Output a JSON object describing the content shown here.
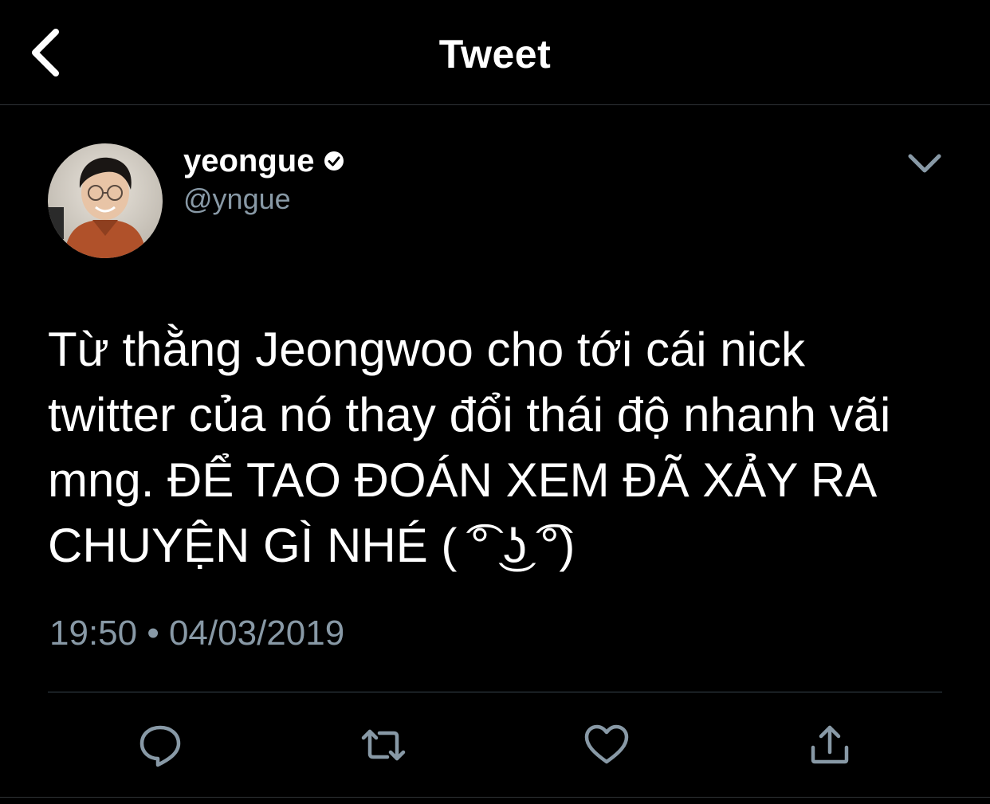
{
  "header": {
    "title": "Tweet",
    "back_icon": "chevron-left-icon"
  },
  "tweet": {
    "author": {
      "display_name": "yeongue",
      "handle": "@yngue",
      "verified": true
    },
    "text": "Từ thằng Jeongwoo cho tới cái nick\ntwitter của nó thay đổi thái độ nhanh vãi\nmng. ĐỂ TAO ĐOÁN XEM ĐÃ XẢY RA\nCHUYỆN GÌ NHÉ ( ͡° ͜ʖ ͡°)",
    "timestamp": "19:50 • 04/03/2019"
  },
  "actions": [
    {
      "icon": "reply-icon"
    },
    {
      "icon": "retweet-icon"
    },
    {
      "icon": "like-icon"
    },
    {
      "icon": "share-icon"
    }
  ],
  "colors": {
    "background": "#000000",
    "text": "#ffffff",
    "secondary": "#8899a6",
    "divider": "#38444d"
  }
}
